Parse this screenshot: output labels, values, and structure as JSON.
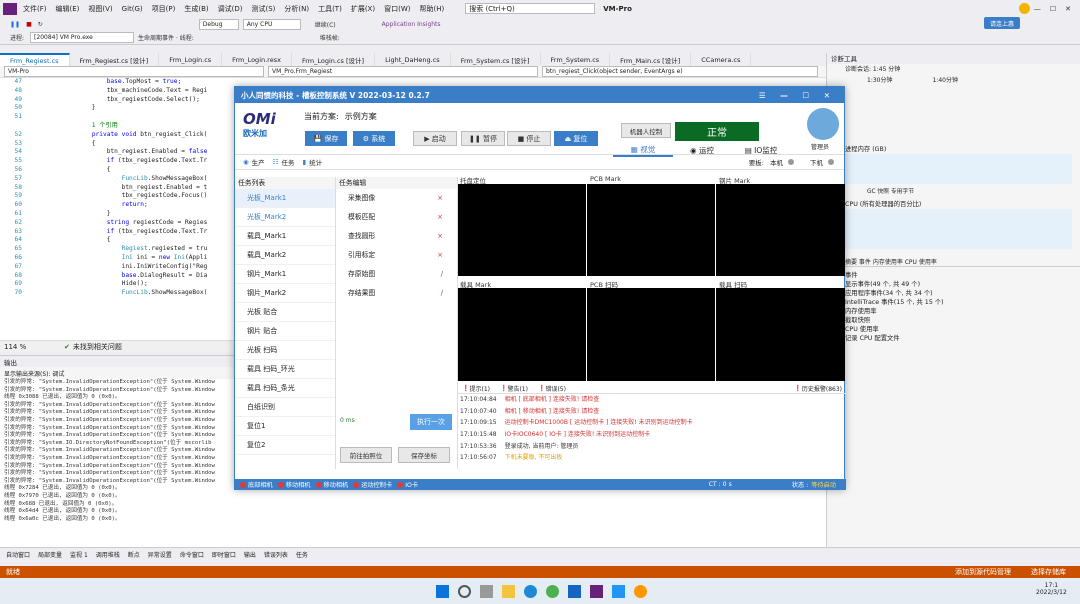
{
  "vs": {
    "menu": [
      "文件(F)",
      "编辑(E)",
      "视图(V)",
      "Git(G)",
      "项目(P)",
      "生成(B)",
      "调试(D)",
      "测试(S)",
      "分析(N)",
      "工具(T)",
      "扩展(X)",
      "窗口(W)",
      "帮助(H)"
    ],
    "search": "搜索 (Ctrl+Q)",
    "title": "VM-Pro",
    "share": "请连上惠",
    "config": "Debug",
    "platform": "Any CPU",
    "start": "继续(C)",
    "insights": "Application Insights",
    "process_label": "进程:",
    "process": "[20084] VM Pro.exe",
    "lifecycle": "生命周期事件 · 线程:",
    "stack": "堆栈帧:",
    "tabs": [
      "Frm_Regiest.cs",
      "Frm_Regiest.cs [设计]",
      "Frm_Login.cs",
      "Frm_Login.resx",
      "Frm_Login.cs [设计]",
      "Light_DaHeng.cs",
      "Frm_System.cs [设计]",
      "Frm_System.cs",
      "Frm_Main.cs [设计]",
      "CCamera.cs"
    ],
    "nav_project": "VM-Pro",
    "nav_class": "VM_Pro.Frm_Regiest",
    "nav_method": "btn_regiest_Click(object sender, EventArgs e)",
    "code": [
      [
        "47",
        "            base.TopMost = true;"
      ],
      [
        "48",
        "            tbx_machineCode.Text = Regi"
      ],
      [
        "49",
        "            tbx_regiestCode.Select();"
      ],
      [
        "50",
        "        }"
      ],
      [
        "51",
        ""
      ],
      [
        "",
        "        1 个引用"
      ],
      [
        "52",
        "        private void btn_regiest_Click("
      ],
      [
        "53",
        "        {"
      ],
      [
        "54",
        "            btn_regiest.Enabled = false"
      ],
      [
        "55",
        "            if (tbx_regiestCode.Text.Tr"
      ],
      [
        "56",
        "            {"
      ],
      [
        "57",
        "                FuncLib.ShowMessageBox("
      ],
      [
        "58",
        "                btn_regiest.Enabled = t"
      ],
      [
        "59",
        "                tbx_regiestCode.Focus()"
      ],
      [
        "60",
        "                return;"
      ],
      [
        "61",
        "            }"
      ],
      [
        "62",
        "            string regiestCode = Regies"
      ],
      [
        "63",
        "            if (tbx_regiestCode.Text.Tr"
      ],
      [
        "64",
        "            {"
      ],
      [
        "65",
        "                Regiest.regiested = tru"
      ],
      [
        "66",
        "                Ini ini = new Ini(Appli"
      ],
      [
        "67",
        "                ini.IniWriteConfig(\"Reg"
      ],
      [
        "68",
        "                base.DialogResult = Dia"
      ],
      [
        "69",
        "                Hide();"
      ],
      [
        "70",
        "                FuncLib.ShowMessageBox("
      ]
    ],
    "zoom": "114 %",
    "issues": "未找到相关问题",
    "output_title": "输出",
    "output_source": "显示输出来源(S):  调试",
    "output_lines": [
      "引发的异常: \"System.InvalidOperationException\"(位于 System.Window",
      "引发的异常: \"System.InvalidOperationException\"(位于 System.Window",
      "线程 0x3088 已退出, 返回值为 0 (0x0)。",
      "引发的异常: \"System.InvalidOperationException\"(位于 System.Window",
      "引发的异常: \"System.InvalidOperationException\"(位于 System.Window",
      "引发的异常: \"System.InvalidOperationException\"(位于 System.Window",
      "引发的异常: \"System.InvalidOperationException\"(位于 System.Window",
      "引发的异常: \"System.InvalidOperationException\"(位于 System.Window",
      "引发的异常: \"System.IO.DirectoryNotFoundException\"(位于 mscorlib",
      "引发的异常: \"System.InvalidOperationException\"(位于 System.Window",
      "引发的异常: \"System.InvalidOperationException\"(位于 System.Window",
      "引发的异常: \"System.InvalidOperationException\"(位于 System.Window",
      "引发的异常: \"System.InvalidOperationException\"(位于 System.Window",
      "引发的异常: \"System.InvalidOperationException\"(位于 System.Window",
      "线程 0x7284 已退出, 返回值为 0 (0x0)。",
      "线程 0x7970 已退出, 返回值为 0 (0x0)。",
      "线程 0x688 已退出, 返回值为 0 (0x0)。",
      "线程 0x64d4 已退出, 返回值为 0 (0x0)。",
      "线程 0x6a0c 已退出, 返回值为 0 (0x0)。"
    ],
    "bottom_tabs": [
      "自动窗口",
      "局部变量",
      "监视 1",
      "调用堆栈",
      "断点",
      "异常设置",
      "命令窗口",
      "即时窗口",
      "输出",
      "错误列表",
      "任务"
    ],
    "status_ready": "就绪",
    "status_source": "添加到源代码管理",
    "status_repo": "选择存储库",
    "diag": {
      "title": "诊断工具",
      "session": "诊断会话: 1:45 分钟",
      "t1": "1:30分钟",
      "t2": "1:40分钟",
      "mem": "进程内存 (GB)",
      "legend": "GC  快照  专用字节",
      "cpu": "CPU (所有处理器的百分比)",
      "tabs": "摘要  事件  内存使用率  CPU 使用率",
      "lines": [
        "事件",
        "显示事件(49 个, 共 49 个)",
        "应用程序事件(34 个, 共 34 个)",
        "IntelliTrace 事件(15 个, 共 15 个)",
        "内存使用率",
        "截取快照",
        "CPU 使用率",
        "记录 CPU 配置文件"
      ]
    },
    "taskbar_time": "17:1",
    "taskbar_date": "2022/3/12"
  },
  "app": {
    "title": "小人同惯的科技 - 槽板控制系统  V 2022-03-12 0.2.7",
    "logo": "欧米加",
    "scheme_label": "当前方案:",
    "scheme": "示例方案",
    "save": "保存",
    "system": "系统",
    "controls": [
      "启动",
      "暂停",
      "停止",
      "复位"
    ],
    "robot": "机器人控制",
    "state": "正常",
    "user": "管理员",
    "views": [
      "视觉",
      "运控",
      "IO监控"
    ],
    "sub": [
      "生产",
      "任务",
      "统计"
    ],
    "lights": [
      "要板:",
      "本机",
      "下机"
    ],
    "tasklist_title": "任务列表",
    "tasks": [
      "光板_Mark1",
      "光板_Mark2",
      "载具_Mark1",
      "载具_Mark2",
      "钢片_Mark1",
      "钢片_Mark2",
      "光板 贴合",
      "钢片 贴合",
      "光板 扫码",
      "载具 扫码_环光",
      "载具 扫码_条光",
      "白纸识别",
      "复位1",
      "复位2"
    ],
    "edit_title": "任务编辑",
    "edit_items": [
      [
        "采集图像",
        "×"
      ],
      [
        "模板匹配",
        "×"
      ],
      [
        "查找圆形",
        "×"
      ],
      [
        "引用标定",
        "×"
      ],
      [
        "存原始图",
        "/"
      ],
      [
        "存结果图",
        "/"
      ]
    ],
    "time": "0 ms",
    "run_once": "执行一次",
    "goto_photo": "前往拍照位",
    "save_coord": "保存坐标",
    "cams": [
      "托盘定位",
      "PCB Mark",
      "钢片 Mark",
      "载具 Mark",
      "PCB 扫码",
      "载具 扫码"
    ],
    "log_tabs": [
      "提示(1)",
      "警告(1)",
      "错误(5)",
      "历史报警(863)"
    ],
    "logs": [
      [
        "17:10:04:84",
        "相机 [ 底部相机 ] 连接失败! 请检查",
        "#d32f2f"
      ],
      [
        "17:10:07:40",
        "相机 [ 移动相机 ] 连接失败! 请检查",
        "#d32f2f"
      ],
      [
        "17:10:09:15",
        "运动控制卡DMC1000B [ 运动控制卡 ] 连接失败! 未识别到运动控制卡",
        "#d32f2f"
      ],
      [
        "17:10:15:48",
        "IO卡IOC0640 [ IO卡 ] 连接失败! 未识别到运动控制卡",
        "#d32f2f"
      ],
      [
        "17:10:53:36",
        "登录成功, 当前用户: 管理员",
        "#333333"
      ],
      [
        "17:10:56:07",
        "下机未要板, 不可出板",
        "#e6a100"
      ]
    ],
    "status_items": [
      "底部相机",
      "移动相机",
      "移动相机",
      "运动控制卡",
      "IO卡"
    ],
    "ct": "CT : 0 s",
    "state_label": "状态 :",
    "state_val": "等待启动"
  }
}
